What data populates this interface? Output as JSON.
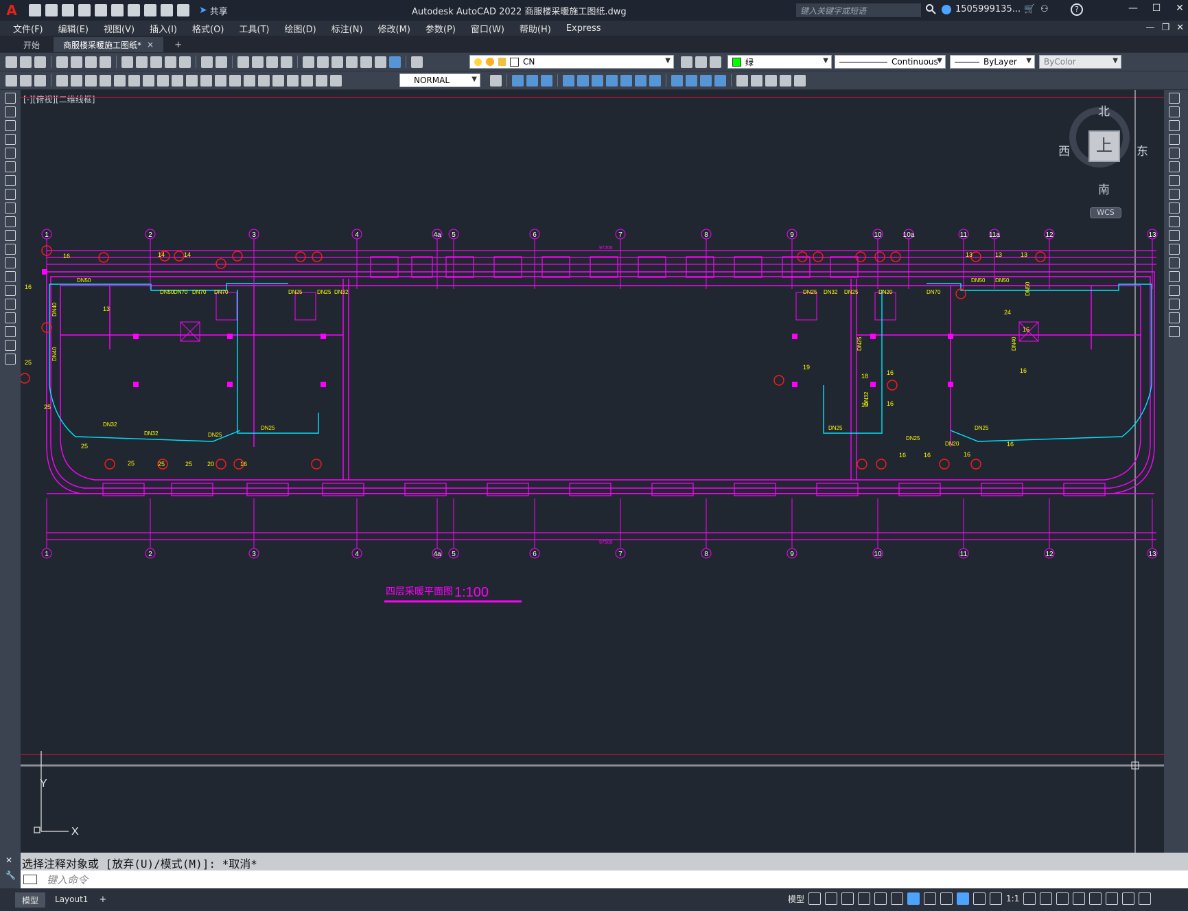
{
  "titlebar": {
    "logo": "A",
    "share_label": "共享",
    "app_title": "Autodesk AutoCAD 2022    商服楼采暖施工图纸.dwg",
    "search_placeholder": "键入关键字或短语",
    "user_name": "1505999135...",
    "help_label": "?"
  },
  "menubar": {
    "items": [
      "文件(F)",
      "编辑(E)",
      "视图(V)",
      "插入(I)",
      "格式(O)",
      "工具(T)",
      "绘图(D)",
      "标注(N)",
      "修改(M)",
      "参数(P)",
      "窗口(W)",
      "帮助(H)",
      "Express"
    ]
  },
  "filetabs": {
    "start": "开始",
    "active": "商服楼采暖施工图纸*",
    "close": "×",
    "add": "+"
  },
  "toolbar1": {
    "layer": "CN",
    "color": "绿",
    "color_hex": "#00ff00",
    "linetype": "Continuous",
    "lineweight": "ByLayer",
    "plotstyle": "ByColor"
  },
  "toolbar2": {
    "dimstyle": "NORMAL"
  },
  "viewport": {
    "label": "[-][俯视][二维线框]"
  },
  "viewcube": {
    "north": "北",
    "south": "南",
    "east": "东",
    "west": "西",
    "face": "上",
    "wcs": "WCS"
  },
  "drawing": {
    "plan_title": "四层采暖平面图",
    "plan_scale": "1:100",
    "ucs_x": "X",
    "ucs_y": "Y",
    "top_dim_total": "97200",
    "bottom_dim_total": "97500",
    "grid_top": [
      "1",
      "2",
      "3",
      "4",
      "4a",
      "5",
      "6",
      "7",
      "8",
      "9",
      "10",
      "10a",
      "11",
      "11a",
      "12",
      "13"
    ],
    "grid_bottom": [
      "1",
      "2",
      "3",
      "4",
      "4a",
      "5",
      "6",
      "7",
      "8",
      "9",
      "10",
      "11",
      "12",
      "13"
    ],
    "pipe_labels": [
      "DN50",
      "DN50",
      "DN70",
      "DN70",
      "DN70",
      "DN25",
      "DN25",
      "DN32",
      "DN40",
      "DN40",
      "DN32",
      "DN32",
      "DN25",
      "DN25",
      "DN25",
      "DN32",
      "DN25",
      "DN25",
      "DN20",
      "DN70",
      "DN50",
      "DN50",
      "DN50",
      "DN40",
      "DN25",
      "DN32",
      "DN25",
      "DN20",
      "DN25"
    ],
    "numbers": [
      "16",
      "14",
      "14",
      "16",
      "13",
      "25",
      "25",
      "25",
      "25",
      "25",
      "25",
      "20",
      "16",
      "13",
      "13",
      "13",
      "24",
      "16",
      "16",
      "19",
      "18",
      "19",
      "16",
      "16",
      "16",
      "16",
      "16",
      "16"
    ],
    "colors": {
      "magenta": "#ff00ff",
      "cyan": "#00e5ff",
      "yellow": "#ffff00",
      "red": "#ff1a1a",
      "border_red": "#b0143a",
      "background": "#212731"
    }
  },
  "command": {
    "history": "选择注释对象或 [放弃(U)/模式(M)]: *取消*",
    "placeholder": "键入命令"
  },
  "statusbar": {
    "tabs": [
      "模型",
      "Layout1"
    ],
    "add": "+",
    "model_label": "模型",
    "scale": "1:1"
  }
}
